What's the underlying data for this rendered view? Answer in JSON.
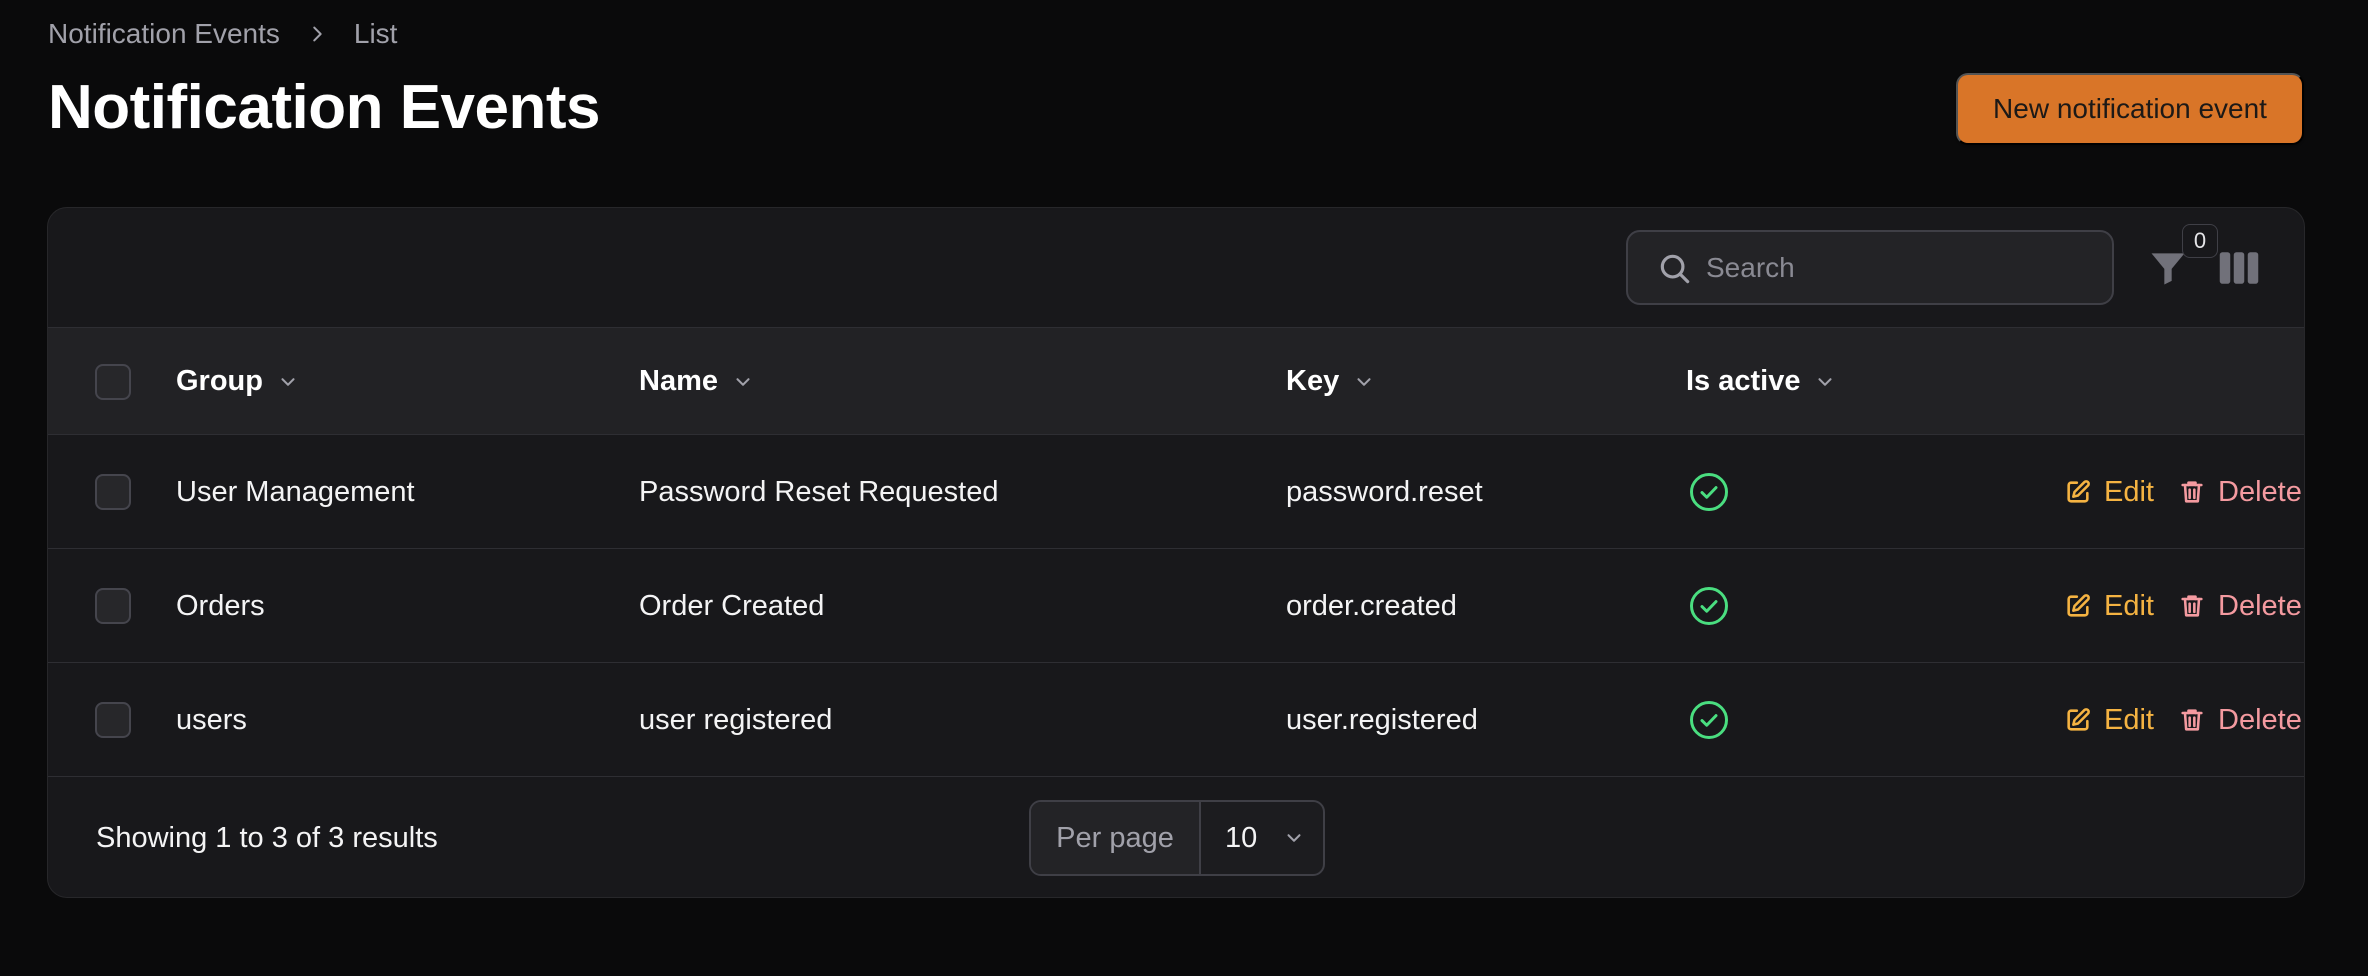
{
  "breadcrumb": {
    "items": [
      "Notification Events",
      "List"
    ]
  },
  "header": {
    "title": "Notification Events",
    "new_button_label": "New notification event"
  },
  "toolbar": {
    "search_placeholder": "Search",
    "filter_count": "0"
  },
  "table": {
    "columns": [
      "Group",
      "Name",
      "Key",
      "Is active"
    ],
    "rows": [
      {
        "group": "User Management",
        "name": "Password Reset Requested",
        "key": "password.reset",
        "is_active": true
      },
      {
        "group": "Orders",
        "name": "Order Created",
        "key": "order.created",
        "is_active": true
      },
      {
        "group": "users",
        "name": "user registered",
        "key": "user.registered",
        "is_active": true
      }
    ],
    "edit_label": "Edit",
    "delete_label": "Delete"
  },
  "footer": {
    "showing_text": "Showing 1 to 3 of 3 results",
    "per_page_label": "Per page",
    "per_page_value": "10"
  },
  "colors": {
    "primary": "#d97528",
    "edit": "#f5b342",
    "delete": "#f49aa0",
    "active": "#4ade80"
  },
  "icons": {
    "search": "search-icon",
    "filter": "filter-icon",
    "columns": "columns-icon",
    "active": "check-circle-icon",
    "edit": "pencil-square-icon",
    "delete": "trash-icon"
  }
}
